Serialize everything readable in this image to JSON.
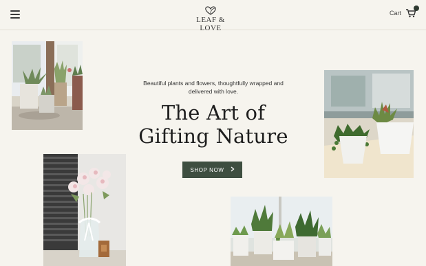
{
  "header": {
    "menu_icon": "hamburger-menu-icon",
    "logo": {
      "text": "LEAF & LOVE",
      "icon": "heart-leaf-icon"
    },
    "cart": {
      "label": "Cart",
      "icon": "shopping-cart-icon",
      "badge": ""
    }
  },
  "hero": {
    "tagline": "Beautiful plants and flowers, thoughtfully wrapped and delivered with love.",
    "headline_line1": "The Art of",
    "headline_line2": "Gifting Nature",
    "cta_label": "SHOP NOW",
    "cta_icon": "chevron-right-icon"
  },
  "photos": [
    {
      "name": "windowsill-succulents-photo"
    },
    {
      "name": "potted-succulents-window-photo"
    },
    {
      "name": "flowers-in-vase-photo"
    },
    {
      "name": "potted-plants-row-photo"
    }
  ],
  "colors": {
    "background": "#f6f4ee",
    "accent": "#3e4e40",
    "text": "#1e1e1e"
  }
}
